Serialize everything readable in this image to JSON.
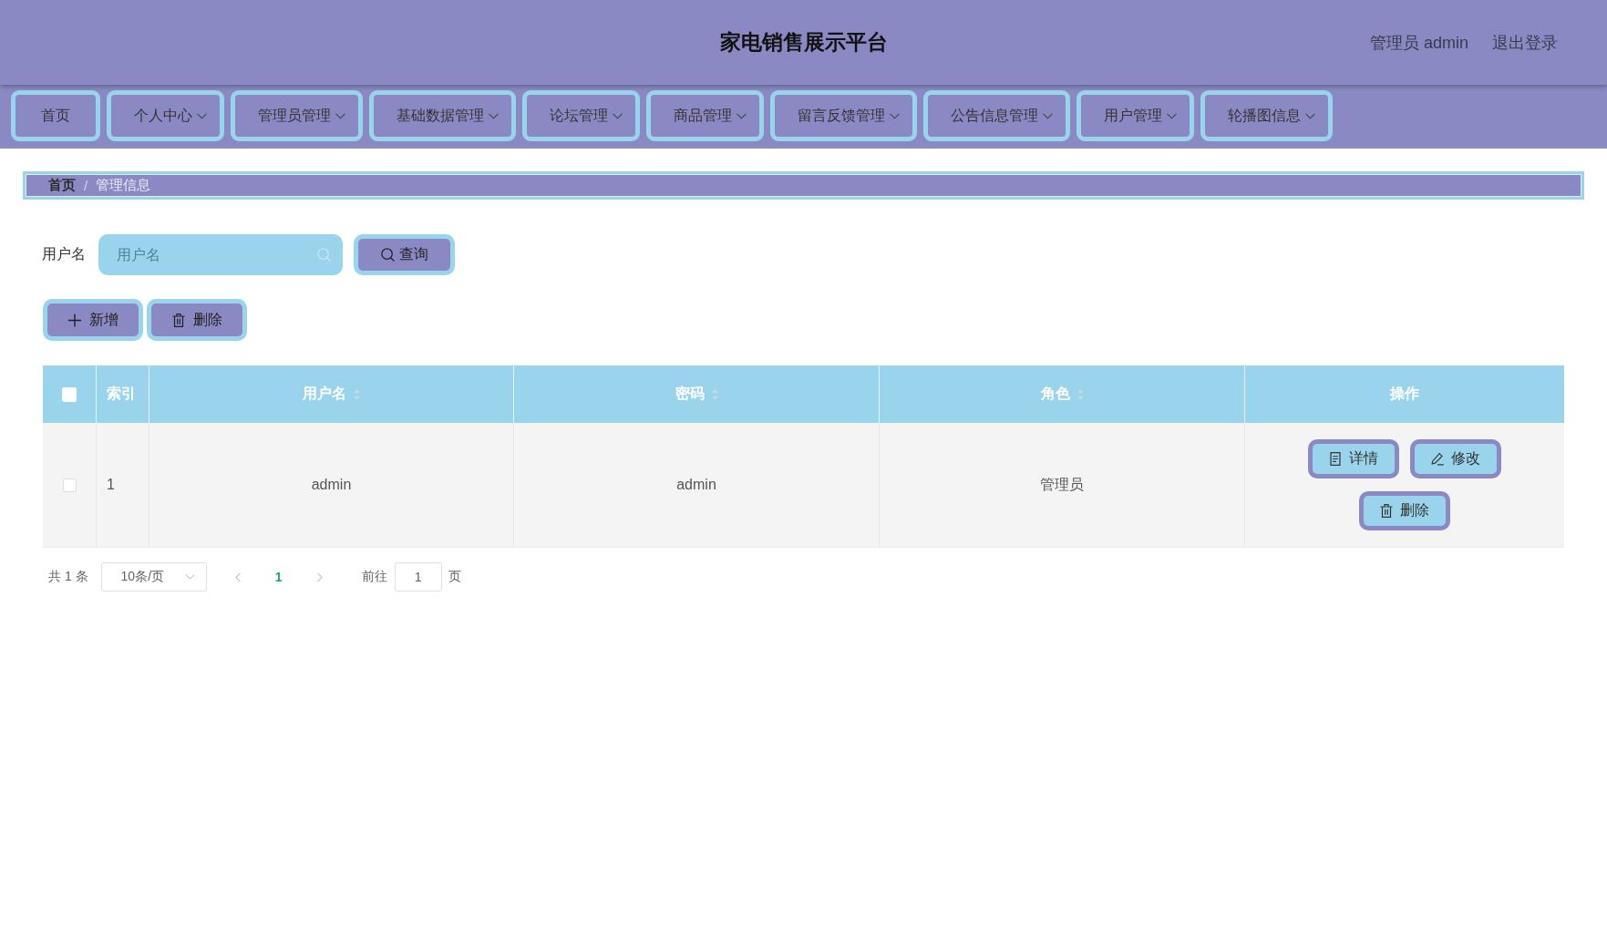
{
  "header": {
    "title": "家电销售展示平台",
    "user": "管理员 admin",
    "logout": "退出登录"
  },
  "nav": [
    {
      "label": "首页",
      "has_dropdown": false
    },
    {
      "label": "个人中心",
      "has_dropdown": true
    },
    {
      "label": "管理员管理",
      "has_dropdown": true
    },
    {
      "label": "基础数据管理",
      "has_dropdown": true
    },
    {
      "label": "论坛管理",
      "has_dropdown": true
    },
    {
      "label": "商品管理",
      "has_dropdown": true
    },
    {
      "label": "留言反馈管理",
      "has_dropdown": true
    },
    {
      "label": "公告信息管理",
      "has_dropdown": true
    },
    {
      "label": "用户管理",
      "has_dropdown": true
    },
    {
      "label": "轮播图信息",
      "has_dropdown": true
    }
  ],
  "breadcrumb": {
    "separator": "/",
    "items": [
      {
        "label": "首页",
        "current": false
      },
      {
        "label": "管理信息",
        "current": true
      }
    ]
  },
  "search": {
    "label": "用户名",
    "placeholder": "用户名",
    "button": "查询"
  },
  "actions": [
    {
      "kind": "add",
      "label": "新增"
    },
    {
      "kind": "delete",
      "label": "删除"
    }
  ],
  "table": {
    "select_all": {
      "checked": false
    },
    "columns": [
      {
        "kind": "index",
        "label": "索引",
        "sortable": false
      },
      {
        "kind": "text",
        "label": "用户名",
        "sortable": true
      },
      {
        "kind": "text",
        "label": "密码",
        "sortable": true
      },
      {
        "kind": "text",
        "label": "角色",
        "sortable": true
      },
      {
        "kind": "actions",
        "label": "操作",
        "sortable": false
      }
    ],
    "rows": [
      {
        "checked": false,
        "cells": [
          "1",
          "admin",
          "admin",
          "管理员"
        ],
        "actions": [
          {
            "kind": "detail",
            "label": "详情"
          },
          {
            "kind": "edit",
            "label": "修改"
          },
          {
            "kind": "delete",
            "label": "删除"
          }
        ]
      }
    ]
  },
  "pagination": {
    "total": "共 1 条",
    "page_size": "10条/页",
    "prev": {
      "disabled": true
    },
    "pages": [
      {
        "label": "1",
        "selected": true
      }
    ],
    "next": {
      "disabled": true
    },
    "goto_label": "前往",
    "goto_value": "1",
    "goto_suffix": "页"
  }
}
